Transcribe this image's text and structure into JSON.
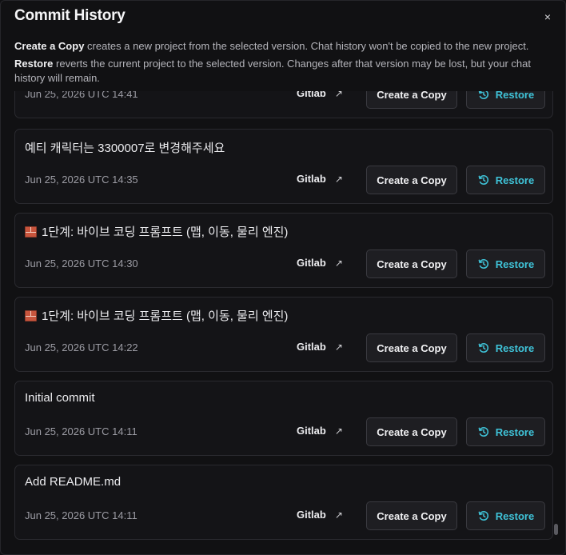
{
  "dialog": {
    "title": "Commit History",
    "close_label": "×",
    "desc1_bold": "Create a Copy",
    "desc1_text": " creates a new project from the selected version. Chat history won't be copied to the new project.",
    "desc2_bold": "Restore",
    "desc2_text": " reverts the current project to the selected version. Changes after that version may be lost, but your chat history will remain."
  },
  "buttons": {
    "gitlab": "Gitlab",
    "gitlab_arrow": "↗",
    "copy": "Create a Copy",
    "restore": "Restore"
  },
  "commits": [
    {
      "message": "",
      "date": "Jun 25, 2026 UTC 14:41",
      "icon": ""
    },
    {
      "message": "예티 캐릭터는 3300007로 변경해주세요",
      "date": "Jun 25, 2026 UTC 14:35",
      "icon": ""
    },
    {
      "message": "1단계: 바이브 코딩 프롬프트 (맵, 이동, 물리 엔진)",
      "date": "Jun 25, 2026 UTC 14:30",
      "icon": "brick-icon"
    },
    {
      "message": "1단계: 바이브 코딩 프롬프트 (맵, 이동, 물리 엔진)",
      "date": "Jun 25, 2026 UTC 14:22",
      "icon": "brick-icon"
    },
    {
      "message": "Initial commit",
      "date": "Jun 25, 2026 UTC 14:11",
      "icon": ""
    },
    {
      "message": "Add README.md",
      "date": "Jun 25, 2026 UTC 14:11",
      "icon": ""
    }
  ],
  "colors": {
    "accent": "#3fc3d8",
    "background": "#111113",
    "card": "#141417"
  }
}
